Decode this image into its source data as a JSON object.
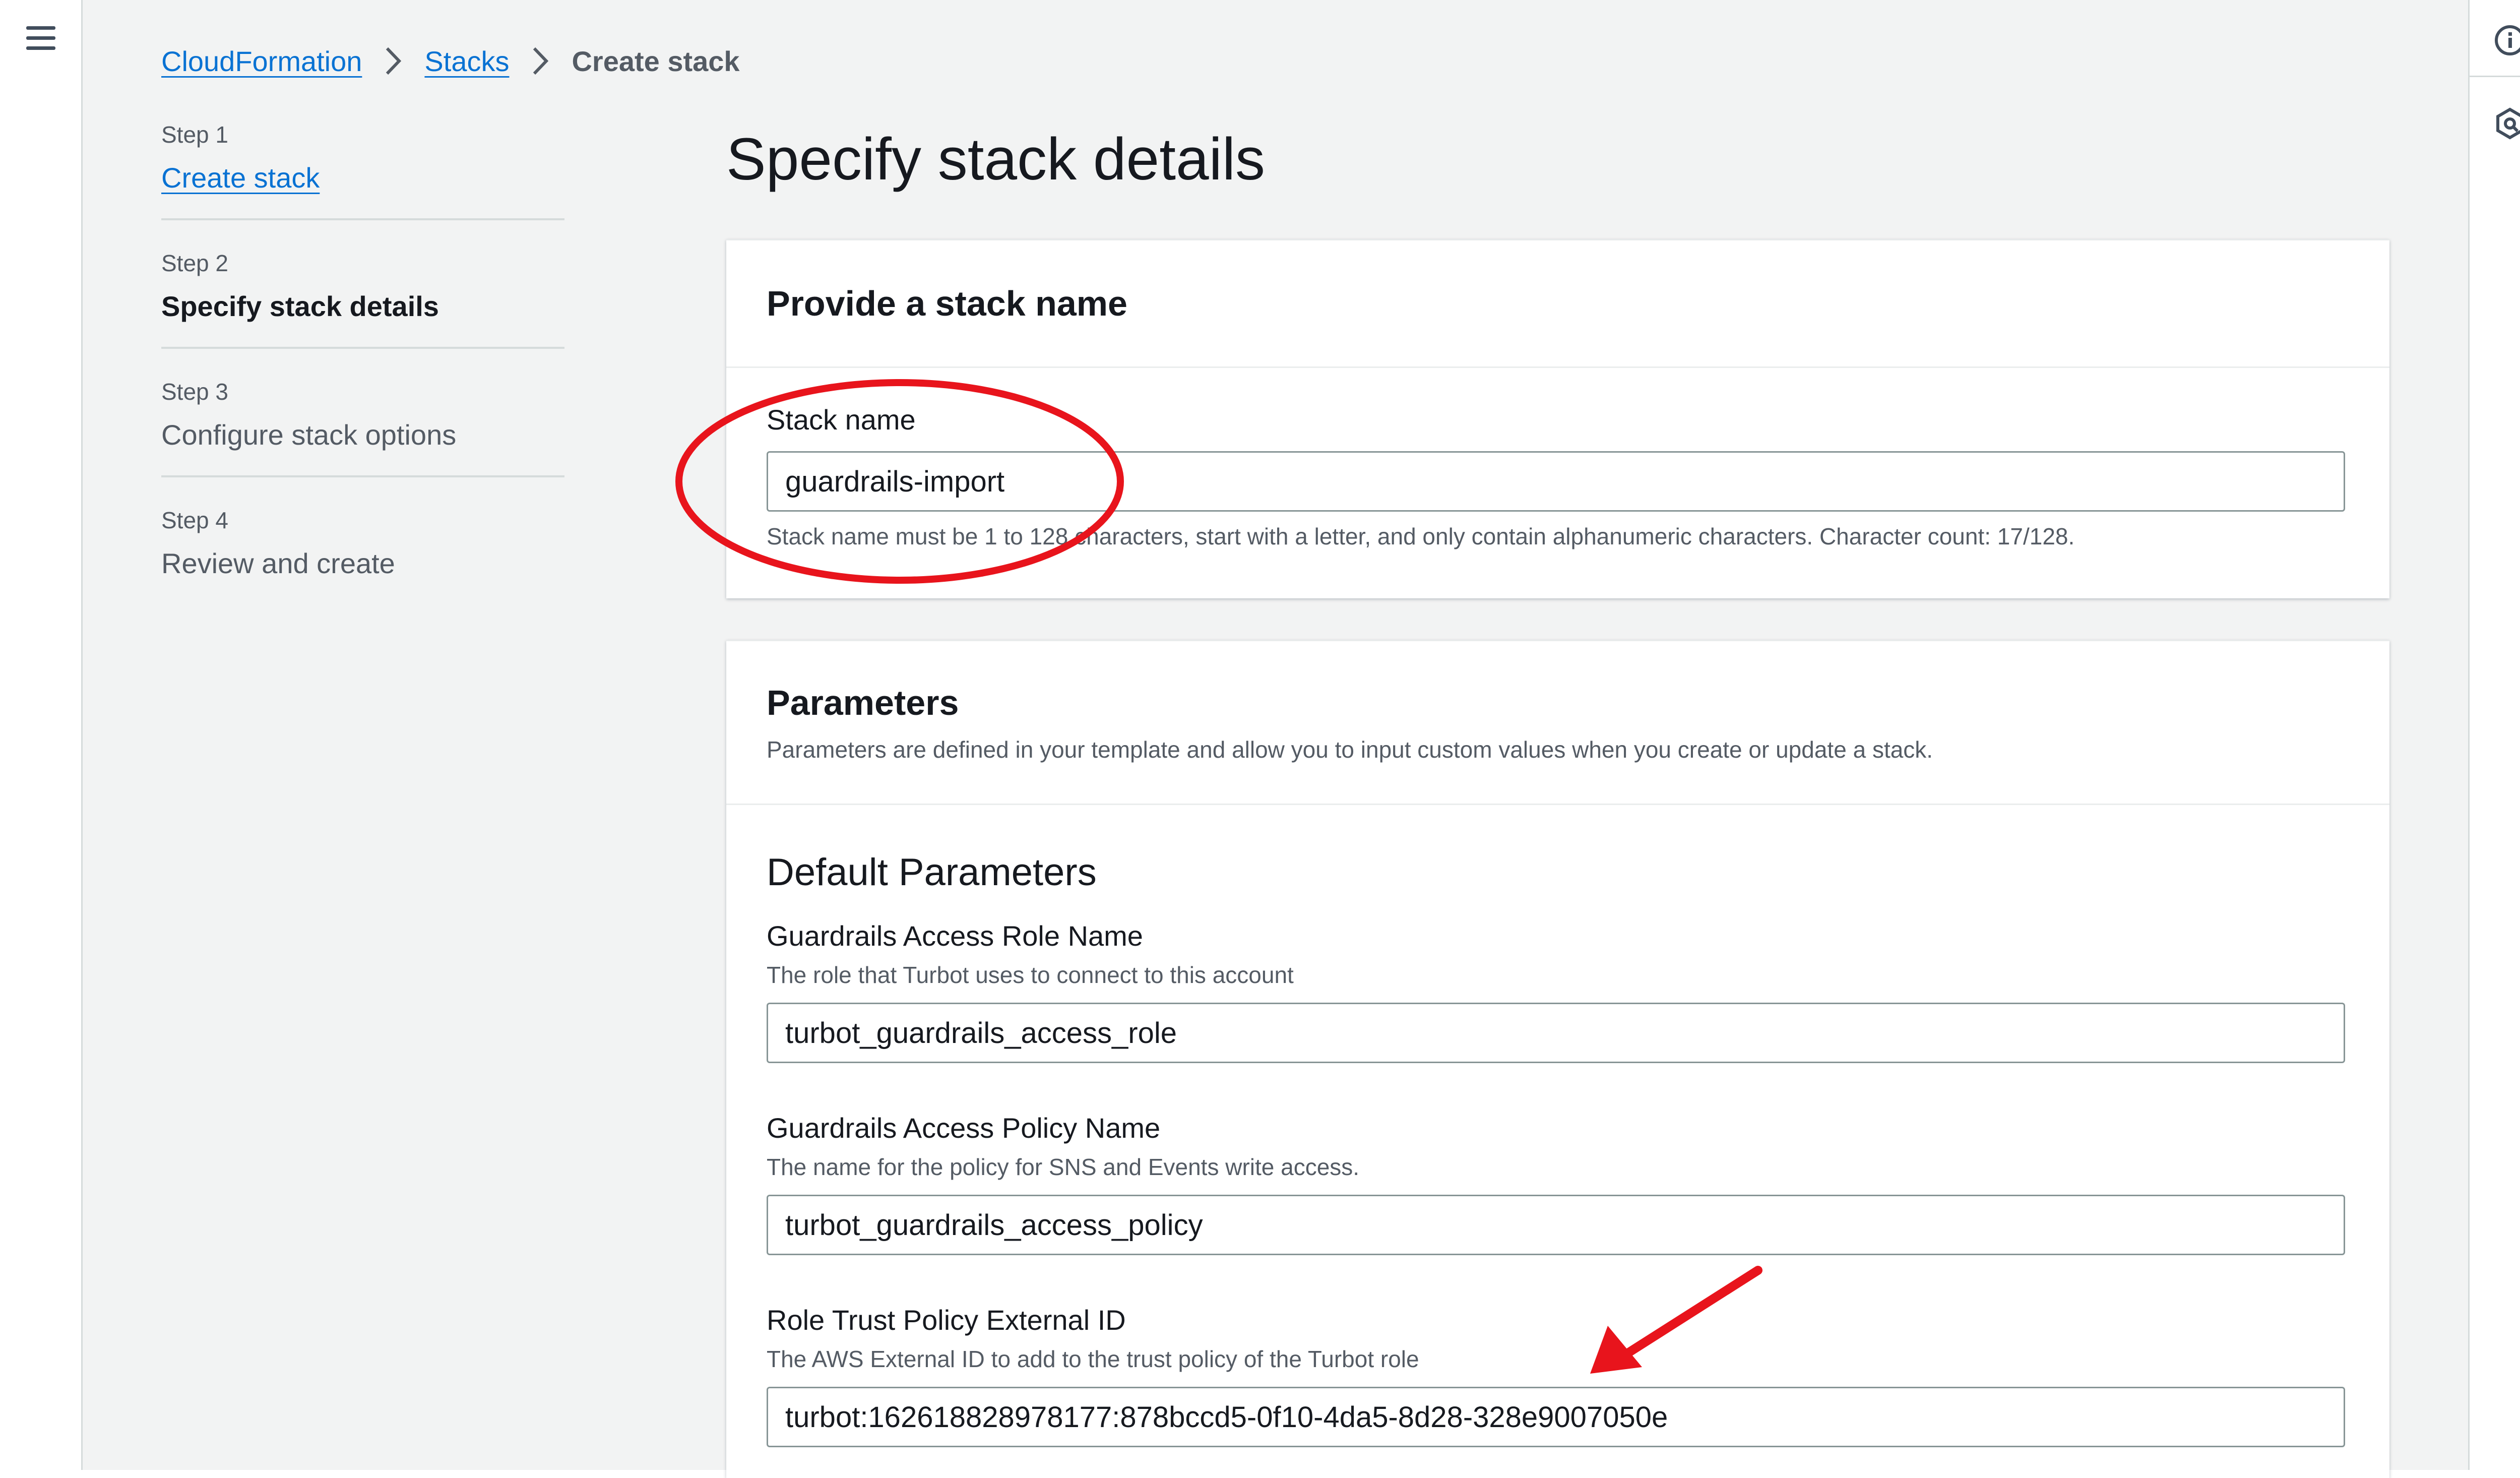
{
  "breadcrumb": {
    "items": [
      "CloudFormation",
      "Stacks"
    ],
    "current": "Create stack"
  },
  "wizard": {
    "steps": [
      {
        "number": "Step 1",
        "title": "Create stack"
      },
      {
        "number": "Step 2",
        "title": "Specify stack details"
      },
      {
        "number": "Step 3",
        "title": "Configure stack options"
      },
      {
        "number": "Step 4",
        "title": "Review and create"
      }
    ]
  },
  "page": {
    "title": "Specify stack details"
  },
  "stack_name_panel": {
    "title": "Provide a stack name",
    "label": "Stack name",
    "value": "guardrails-import",
    "hint": "Stack name must be 1 to 128 characters, start with a letter, and only contain alphanumeric characters. Character count: 17/128."
  },
  "parameters_panel": {
    "title": "Parameters",
    "description": "Parameters are defined in your template and allow you to input custom values when you create or update a stack.",
    "section_title": "Default Parameters",
    "fields": [
      {
        "label": "Guardrails Access Role Name",
        "description": "The role that Turbot uses to connect to this account",
        "value": "turbot_guardrails_access_role"
      },
      {
        "label": "Guardrails Access Policy Name",
        "description": "The name for the policy for SNS and Events write access.",
        "value": "turbot_guardrails_access_policy"
      },
      {
        "label": "Role Trust Policy External ID",
        "description": "The AWS External ID to add to the trust policy of the Turbot role",
        "value": "turbot:162618828978177:878bccd5-0f10-4da5-8d28-328e9007050e"
      }
    ]
  },
  "icons": {
    "menu": "hamburger-menu-icon",
    "info": "info-icon",
    "help_panel": "settings-hexagon-icon",
    "breadcrumb_separator": "chevron-right-icon"
  },
  "colors": {
    "link": "#0972d3",
    "annotation": "#e8141c",
    "background": "#f2f3f3"
  }
}
